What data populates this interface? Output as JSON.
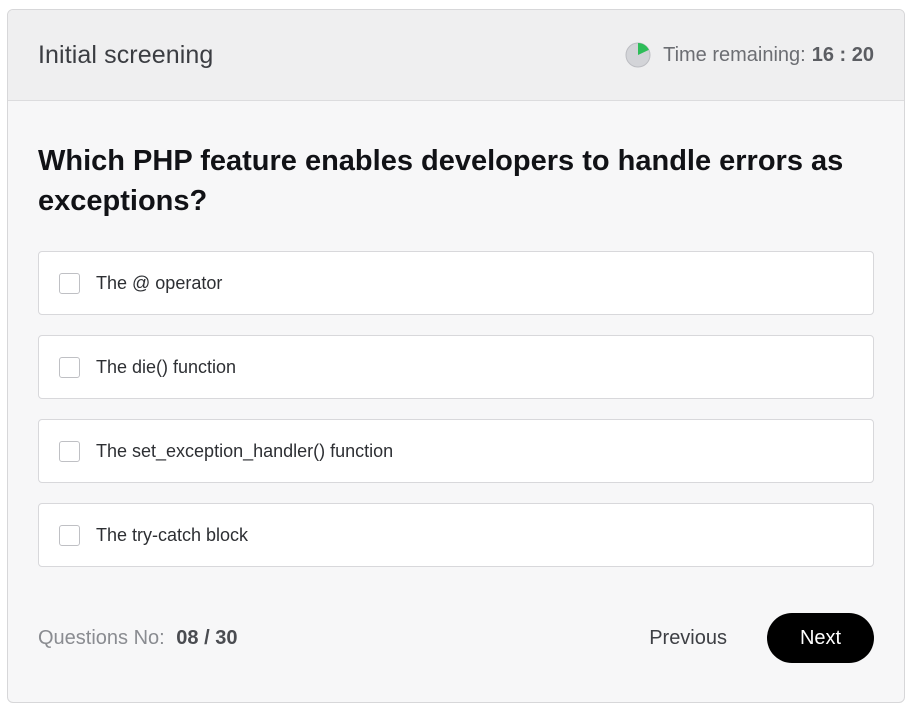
{
  "header": {
    "title": "Initial screening",
    "timer_label": "Time remaining:",
    "timer_value": "16 : 20",
    "timer_progress": 0.18,
    "timer_colors": {
      "elapsed": "#2ebd59",
      "remaining": "#d3d4d8"
    }
  },
  "question": {
    "text": "Which PHP feature enables developers to handle errors as exceptions?",
    "options": [
      {
        "label": "The @ operator",
        "checked": false
      },
      {
        "label": "The die() function",
        "checked": false
      },
      {
        "label": "The set_exception_handler() function",
        "checked": false
      },
      {
        "label": "The try-catch block",
        "checked": false
      }
    ]
  },
  "footer": {
    "counter_label": "Questions No:",
    "counter_value": "08 / 30",
    "previous_label": "Previous",
    "next_label": "Next"
  },
  "colors": {
    "accent": "#000000",
    "background": "#f7f7f8",
    "header_background": "#efeff0"
  }
}
